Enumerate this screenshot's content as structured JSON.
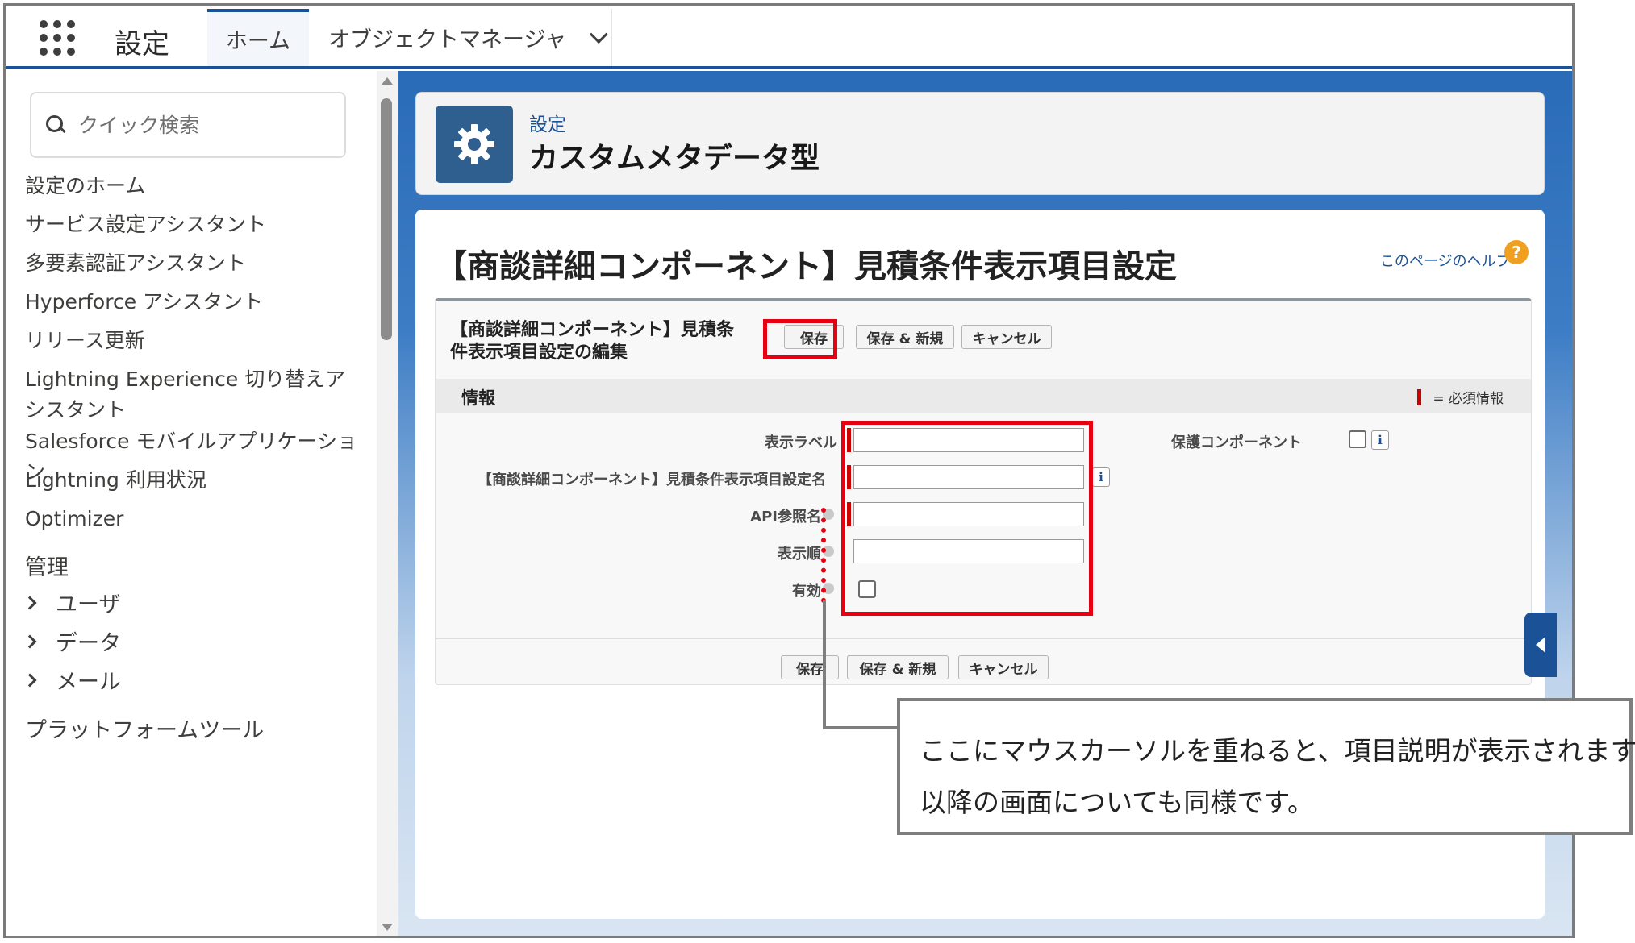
{
  "topbar": {
    "app_title": "設定",
    "tabs": [
      {
        "label": "ホーム"
      },
      {
        "label": "オブジェクトマネージャ"
      }
    ]
  },
  "sidebar": {
    "search_placeholder": "クイック検索",
    "items": [
      {
        "label": "設定のホーム"
      },
      {
        "label": "サービス設定アシスタント"
      },
      {
        "label": "多要素認証アシスタント"
      },
      {
        "label": "Hyperforce アシスタント"
      },
      {
        "label": "リリース更新"
      },
      {
        "label": "Lightning Experience 切り替えアシスタント"
      },
      {
        "label": "Salesforce モバイルアプリケーション"
      },
      {
        "label": "Lightning 利用状況"
      },
      {
        "label": "Optimizer"
      }
    ],
    "admin_section": "管理",
    "admin_groups": [
      {
        "label": "ユーザ"
      },
      {
        "label": "データ"
      },
      {
        "label": "メール"
      }
    ],
    "platform_section": "プラットフォームツール"
  },
  "header": {
    "kicker": "設定",
    "title": "カスタムメタデータ型",
    "icon": "gear-icon"
  },
  "record": {
    "title": "【商談詳細コンポーネント】見積条件表示項目設定",
    "help_link": "このページのヘルプ",
    "edit_heading": "【商談詳細コンポーネント】見積条件表示項目設定の編集",
    "buttons": {
      "save": "保存",
      "save_new": "保存 & 新規",
      "cancel": "キャンセル"
    },
    "section_title": "情報",
    "required_legend": "= 必須情報",
    "fields": {
      "label": {
        "label": "表示ラベル",
        "value": ""
      },
      "name": {
        "label": "【商談詳細コンポーネント】見積条件表示項目設定名",
        "value": ""
      },
      "api_name": {
        "label": "API参照名",
        "value": ""
      },
      "order": {
        "label": "表示順",
        "value": ""
      },
      "active": {
        "label": "有効",
        "checked": false
      },
      "protected": {
        "label": "保護コンポーネント",
        "checked": false
      }
    },
    "info_glyph": "i"
  },
  "annotation": {
    "line1": "ここにマウスカーソルを重ねると、項目説明が表示されます。",
    "line2": "以降の画面についても同様です。",
    "highlight_color": "#e60012",
    "callout_border": "#7e7e7e"
  },
  "colors": {
    "brand_blue": "#1b5297",
    "required_red": "#cc0000",
    "help_orange": "#f0a020"
  }
}
